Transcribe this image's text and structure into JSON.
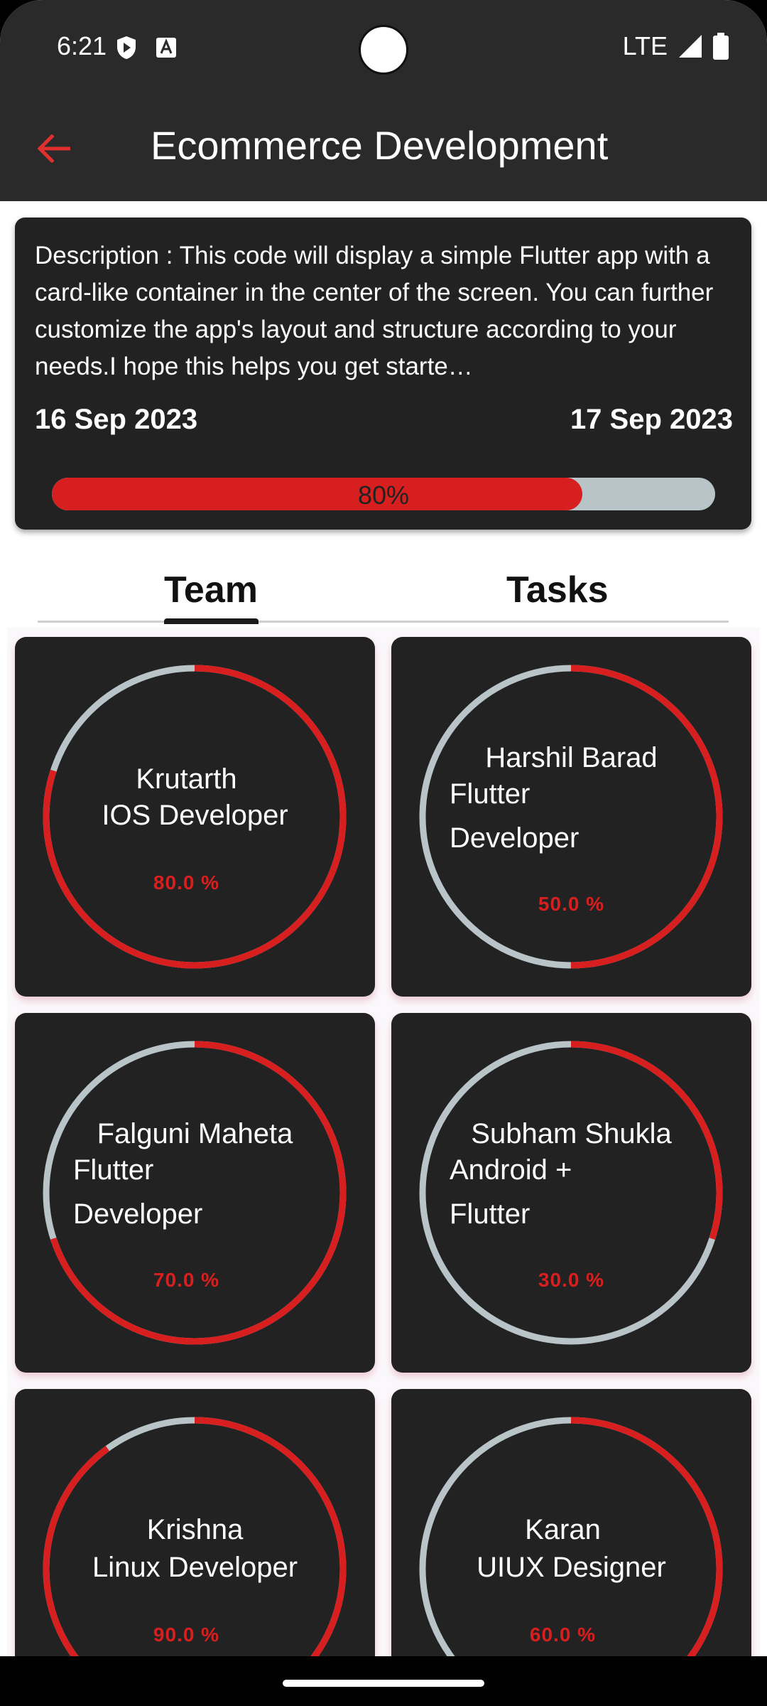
{
  "status_bar": {
    "time": "6:21",
    "network": "LTE"
  },
  "app_bar": {
    "title": "Ecommerce Development",
    "back_icon": "arrow-back-icon"
  },
  "project": {
    "description": "Description : This code will display a simple Flutter app with a card-like container in the center of the screen. You can further customize the app's layout and structure according to your needs.I hope this helps you get starte…",
    "start_date": "16 Sep 2023",
    "end_date": "17 Sep 2023",
    "progress_label": "80%",
    "progress_fraction": 0.8
  },
  "tabs": [
    {
      "label": "Team",
      "selected": true
    },
    {
      "label": "Tasks",
      "selected": false
    }
  ],
  "team": [
    {
      "name": "Krutarth",
      "role": "IOS Developer",
      "percent_label": "80.0 %",
      "progress": 0.8
    },
    {
      "name": "Harshil Barad",
      "role": "Flutter Developer",
      "percent_label": "50.0 %",
      "progress": 0.5
    },
    {
      "name": "Falguni Maheta",
      "role": "Flutter Developer",
      "percent_label": "70.0 %",
      "progress": 0.7
    },
    {
      "name": "Subham Shukla",
      "role": "Android + Flutter",
      "percent_label": "30.0 %",
      "progress": 0.3
    },
    {
      "name": "Krishna",
      "role": "Linux Developer",
      "percent_label": "90.0 %",
      "progress": 0.9
    },
    {
      "name": "Karan",
      "role": "UIUX Designer",
      "percent_label": "60.0 %",
      "progress": 0.6
    }
  ],
  "colors": {
    "accent": "#d71f1f",
    "track": "#b8c4c8",
    "card": "#222222",
    "appbar": "#2a2a2a"
  }
}
